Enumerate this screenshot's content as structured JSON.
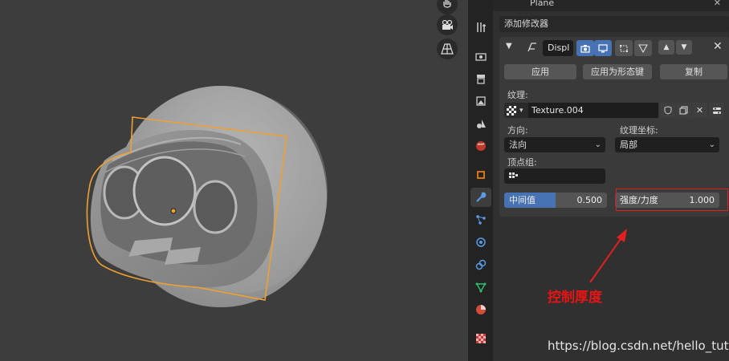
{
  "colors": {
    "accent": "#4772b3",
    "selection_outline": "#f0a030",
    "annotation_red": "#e02020"
  },
  "header": {
    "title": "Plane"
  },
  "add_modifier": {
    "label": "添加修改器"
  },
  "modifier": {
    "name": "Displ",
    "apply_label": "应用",
    "apply_shape_label": "应用为形态键",
    "copy_label": "复制",
    "texture_label": "纹理:",
    "texture_name": "Texture.004",
    "direction_label": "方向:",
    "direction_value": "法向",
    "texcoord_label": "纹理坐标:",
    "texcoord_value": "局部",
    "vertex_group_label": "顶点组:",
    "midlevel": {
      "label": "中间值",
      "value": "0.500",
      "fraction": 0.5
    },
    "strength": {
      "label": "强度/力度",
      "value": "1.000"
    }
  },
  "annotation": {
    "text": "控制厚度"
  },
  "watermark": {
    "text": "https://blog.csdn.net/hello_tute"
  },
  "icons": [
    "hand-icon",
    "camera-view-icon",
    "perspective-grid-icon",
    "tool-icon",
    "render-icon",
    "output-icon",
    "view-layer-icon",
    "scene-icon",
    "world-icon",
    "object-icon",
    "modifier-wrench-icon",
    "particles-icon",
    "physics-icon",
    "constraints-icon",
    "object-data-icon",
    "material-icon",
    "texture-icon"
  ]
}
